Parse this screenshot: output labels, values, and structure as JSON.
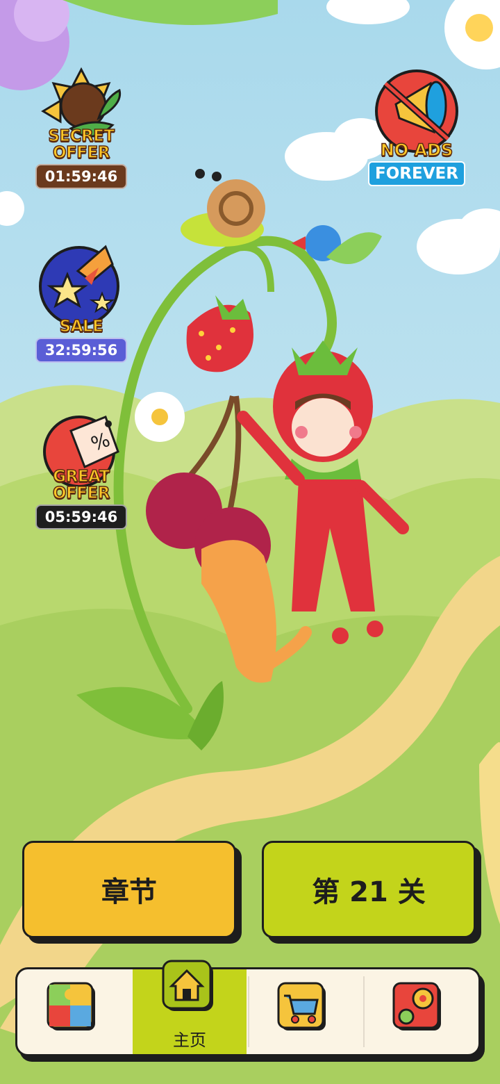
{
  "offers": {
    "secret": {
      "title_line1": "SECRET",
      "title_line2": "OFFER",
      "timer": "01:59:46",
      "timer_color": "#6b3a1d"
    },
    "sale": {
      "title_line1": "SALE",
      "timer": "32:59:56",
      "timer_color": "#5a5ed6"
    },
    "great": {
      "title_line1": "GREAT",
      "title_line2": "OFFER",
      "timer": "05:59:46",
      "timer_color": "#1e1e1e"
    }
  },
  "no_ads": {
    "title": "NO ADS",
    "subtitle": "FOREVER"
  },
  "buttons": {
    "chapters": "章节",
    "level": "第 21 关"
  },
  "nav": {
    "home_label": "主页",
    "active": "home"
  },
  "colors": {
    "sky": "#bfe3f2",
    "button_yellow": "#f5bf2e",
    "button_green": "#c3d41b",
    "nav_bg": "#fbf4e4"
  }
}
